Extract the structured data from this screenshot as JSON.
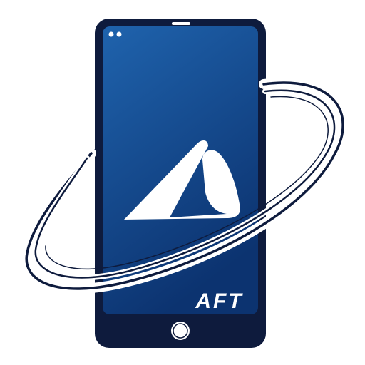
{
  "logo": {
    "brand_text": "AFT"
  },
  "colors": {
    "phone_body": "#0e1b3d",
    "screen_top": "#1d5fa8",
    "screen_bottom": "#0d3570",
    "orbit": "#0e1b3d",
    "mark": "#ffffff"
  },
  "icons": [
    "smartphone-icon",
    "camera-dots-icon",
    "home-button-icon",
    "orbit-ring-icon",
    "aft-mark-icon"
  ]
}
